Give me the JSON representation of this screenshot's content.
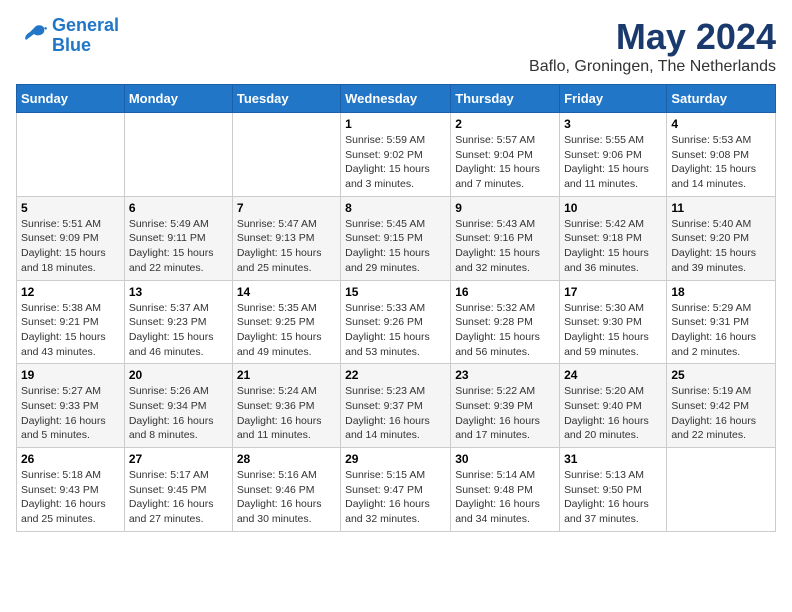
{
  "header": {
    "logo_line1": "General",
    "logo_line2": "Blue",
    "month_title": "May 2024",
    "location": "Baflo, Groningen, The Netherlands"
  },
  "weekdays": [
    "Sunday",
    "Monday",
    "Tuesday",
    "Wednesday",
    "Thursday",
    "Friday",
    "Saturday"
  ],
  "weeks": [
    [
      {
        "day": "",
        "info": ""
      },
      {
        "day": "",
        "info": ""
      },
      {
        "day": "",
        "info": ""
      },
      {
        "day": "1",
        "info": "Sunrise: 5:59 AM\nSunset: 9:02 PM\nDaylight: 15 hours\nand 3 minutes."
      },
      {
        "day": "2",
        "info": "Sunrise: 5:57 AM\nSunset: 9:04 PM\nDaylight: 15 hours\nand 7 minutes."
      },
      {
        "day": "3",
        "info": "Sunrise: 5:55 AM\nSunset: 9:06 PM\nDaylight: 15 hours\nand 11 minutes."
      },
      {
        "day": "4",
        "info": "Sunrise: 5:53 AM\nSunset: 9:08 PM\nDaylight: 15 hours\nand 14 minutes."
      }
    ],
    [
      {
        "day": "5",
        "info": "Sunrise: 5:51 AM\nSunset: 9:09 PM\nDaylight: 15 hours\nand 18 minutes."
      },
      {
        "day": "6",
        "info": "Sunrise: 5:49 AM\nSunset: 9:11 PM\nDaylight: 15 hours\nand 22 minutes."
      },
      {
        "day": "7",
        "info": "Sunrise: 5:47 AM\nSunset: 9:13 PM\nDaylight: 15 hours\nand 25 minutes."
      },
      {
        "day": "8",
        "info": "Sunrise: 5:45 AM\nSunset: 9:15 PM\nDaylight: 15 hours\nand 29 minutes."
      },
      {
        "day": "9",
        "info": "Sunrise: 5:43 AM\nSunset: 9:16 PM\nDaylight: 15 hours\nand 32 minutes."
      },
      {
        "day": "10",
        "info": "Sunrise: 5:42 AM\nSunset: 9:18 PM\nDaylight: 15 hours\nand 36 minutes."
      },
      {
        "day": "11",
        "info": "Sunrise: 5:40 AM\nSunset: 9:20 PM\nDaylight: 15 hours\nand 39 minutes."
      }
    ],
    [
      {
        "day": "12",
        "info": "Sunrise: 5:38 AM\nSunset: 9:21 PM\nDaylight: 15 hours\nand 43 minutes."
      },
      {
        "day": "13",
        "info": "Sunrise: 5:37 AM\nSunset: 9:23 PM\nDaylight: 15 hours\nand 46 minutes."
      },
      {
        "day": "14",
        "info": "Sunrise: 5:35 AM\nSunset: 9:25 PM\nDaylight: 15 hours\nand 49 minutes."
      },
      {
        "day": "15",
        "info": "Sunrise: 5:33 AM\nSunset: 9:26 PM\nDaylight: 15 hours\nand 53 minutes."
      },
      {
        "day": "16",
        "info": "Sunrise: 5:32 AM\nSunset: 9:28 PM\nDaylight: 15 hours\nand 56 minutes."
      },
      {
        "day": "17",
        "info": "Sunrise: 5:30 AM\nSunset: 9:30 PM\nDaylight: 15 hours\nand 59 minutes."
      },
      {
        "day": "18",
        "info": "Sunrise: 5:29 AM\nSunset: 9:31 PM\nDaylight: 16 hours\nand 2 minutes."
      }
    ],
    [
      {
        "day": "19",
        "info": "Sunrise: 5:27 AM\nSunset: 9:33 PM\nDaylight: 16 hours\nand 5 minutes."
      },
      {
        "day": "20",
        "info": "Sunrise: 5:26 AM\nSunset: 9:34 PM\nDaylight: 16 hours\nand 8 minutes."
      },
      {
        "day": "21",
        "info": "Sunrise: 5:24 AM\nSunset: 9:36 PM\nDaylight: 16 hours\nand 11 minutes."
      },
      {
        "day": "22",
        "info": "Sunrise: 5:23 AM\nSunset: 9:37 PM\nDaylight: 16 hours\nand 14 minutes."
      },
      {
        "day": "23",
        "info": "Sunrise: 5:22 AM\nSunset: 9:39 PM\nDaylight: 16 hours\nand 17 minutes."
      },
      {
        "day": "24",
        "info": "Sunrise: 5:20 AM\nSunset: 9:40 PM\nDaylight: 16 hours\nand 20 minutes."
      },
      {
        "day": "25",
        "info": "Sunrise: 5:19 AM\nSunset: 9:42 PM\nDaylight: 16 hours\nand 22 minutes."
      }
    ],
    [
      {
        "day": "26",
        "info": "Sunrise: 5:18 AM\nSunset: 9:43 PM\nDaylight: 16 hours\nand 25 minutes."
      },
      {
        "day": "27",
        "info": "Sunrise: 5:17 AM\nSunset: 9:45 PM\nDaylight: 16 hours\nand 27 minutes."
      },
      {
        "day": "28",
        "info": "Sunrise: 5:16 AM\nSunset: 9:46 PM\nDaylight: 16 hours\nand 30 minutes."
      },
      {
        "day": "29",
        "info": "Sunrise: 5:15 AM\nSunset: 9:47 PM\nDaylight: 16 hours\nand 32 minutes."
      },
      {
        "day": "30",
        "info": "Sunrise: 5:14 AM\nSunset: 9:48 PM\nDaylight: 16 hours\nand 34 minutes."
      },
      {
        "day": "31",
        "info": "Sunrise: 5:13 AM\nSunset: 9:50 PM\nDaylight: 16 hours\nand 37 minutes."
      },
      {
        "day": "",
        "info": ""
      }
    ]
  ]
}
